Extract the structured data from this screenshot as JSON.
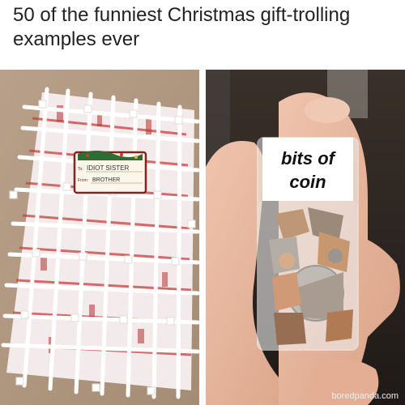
{
  "caption": "50 of the funniest Christmas gift-trolling examples ever",
  "left_photo": {
    "tag_to": "To:",
    "tag_to_name": "IDIOT SISTER",
    "tag_from": "From:",
    "tag_from_name": "BROTHER"
  },
  "right_photo": {
    "label_line1": "bits of",
    "label_line2": "coin",
    "credit": "boredpanda.com"
  },
  "colors": {
    "carpet": "#b49a82",
    "wrapping_paper": "#f4ecec",
    "paper_print": "#c23b3b",
    "zip_ties": "#ffffff",
    "tag_border": "#8c1f1f",
    "background_dark": "#2a2320",
    "skin": "#e6b49c"
  }
}
